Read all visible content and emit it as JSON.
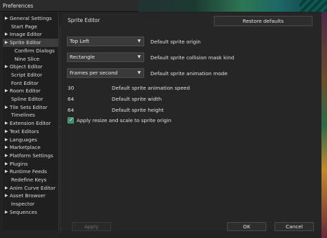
{
  "window": {
    "title": "Preferences"
  },
  "sidebar": {
    "items": [
      {
        "label": "General Settings",
        "arrow": true
      },
      {
        "label": "Start Page",
        "arrow": false
      },
      {
        "label": "Image Editor",
        "arrow": true
      },
      {
        "label": "Sprite Editor",
        "arrow": true,
        "selected": true
      },
      {
        "label": "Confirm Dialogs",
        "arrow": false,
        "indent": 2
      },
      {
        "label": "Nine Slice",
        "arrow": false,
        "indent": 2
      },
      {
        "label": "Object Editor",
        "arrow": true
      },
      {
        "label": "Script Editor",
        "arrow": false
      },
      {
        "label": "Font Editor",
        "arrow": false
      },
      {
        "label": "Room Editor",
        "arrow": true
      },
      {
        "label": "Spline Editor",
        "arrow": false
      },
      {
        "label": "Tile Sets Editor",
        "arrow": true
      },
      {
        "label": "Timelines",
        "arrow": false
      },
      {
        "label": "Extension Editor",
        "arrow": true
      },
      {
        "label": "Text Editors",
        "arrow": true
      },
      {
        "label": "Languages",
        "arrow": true
      },
      {
        "label": "Marketplace",
        "arrow": true
      },
      {
        "label": "Platform Settings",
        "arrow": true
      },
      {
        "label": "Plugins",
        "arrow": true
      },
      {
        "label": "Runtime Feeds",
        "arrow": true
      },
      {
        "label": "Redefine Keys",
        "arrow": false
      },
      {
        "label": "Anim Curve Editor",
        "arrow": true
      },
      {
        "label": "Asset Browser",
        "arrow": true
      },
      {
        "label": "Inspector",
        "arrow": false
      },
      {
        "label": "Sequences",
        "arrow": true
      }
    ]
  },
  "panel": {
    "title": "Sprite Editor",
    "restore_label": "Restore defaults",
    "combos": [
      {
        "value": "Top Left",
        "label": "Default sprite origin"
      },
      {
        "value": "Rectangle",
        "label": "Default sprite collision mask kind"
      },
      {
        "value": "Frames per second",
        "label": "Default sprite animation mode"
      }
    ],
    "numbers": [
      {
        "value": "30",
        "label": "Default sprite animation speed"
      },
      {
        "value": "64",
        "label": "Default sprite width"
      },
      {
        "value": "64",
        "label": "Default sprite height"
      }
    ],
    "checkbox": {
      "label": "Apply resize and scale to sprite origin",
      "checked": true
    }
  },
  "footer": {
    "apply_label": "Apply",
    "ok_label": "OK",
    "cancel_label": "Cancel"
  },
  "colors": {
    "accent_check": "#3d8b6a",
    "selected_bg": "#3c3c3c"
  },
  "icons": {
    "tree_arrow": "triangle-right-icon",
    "combo_caret": "triangle-down-icon",
    "check": "check-icon"
  }
}
